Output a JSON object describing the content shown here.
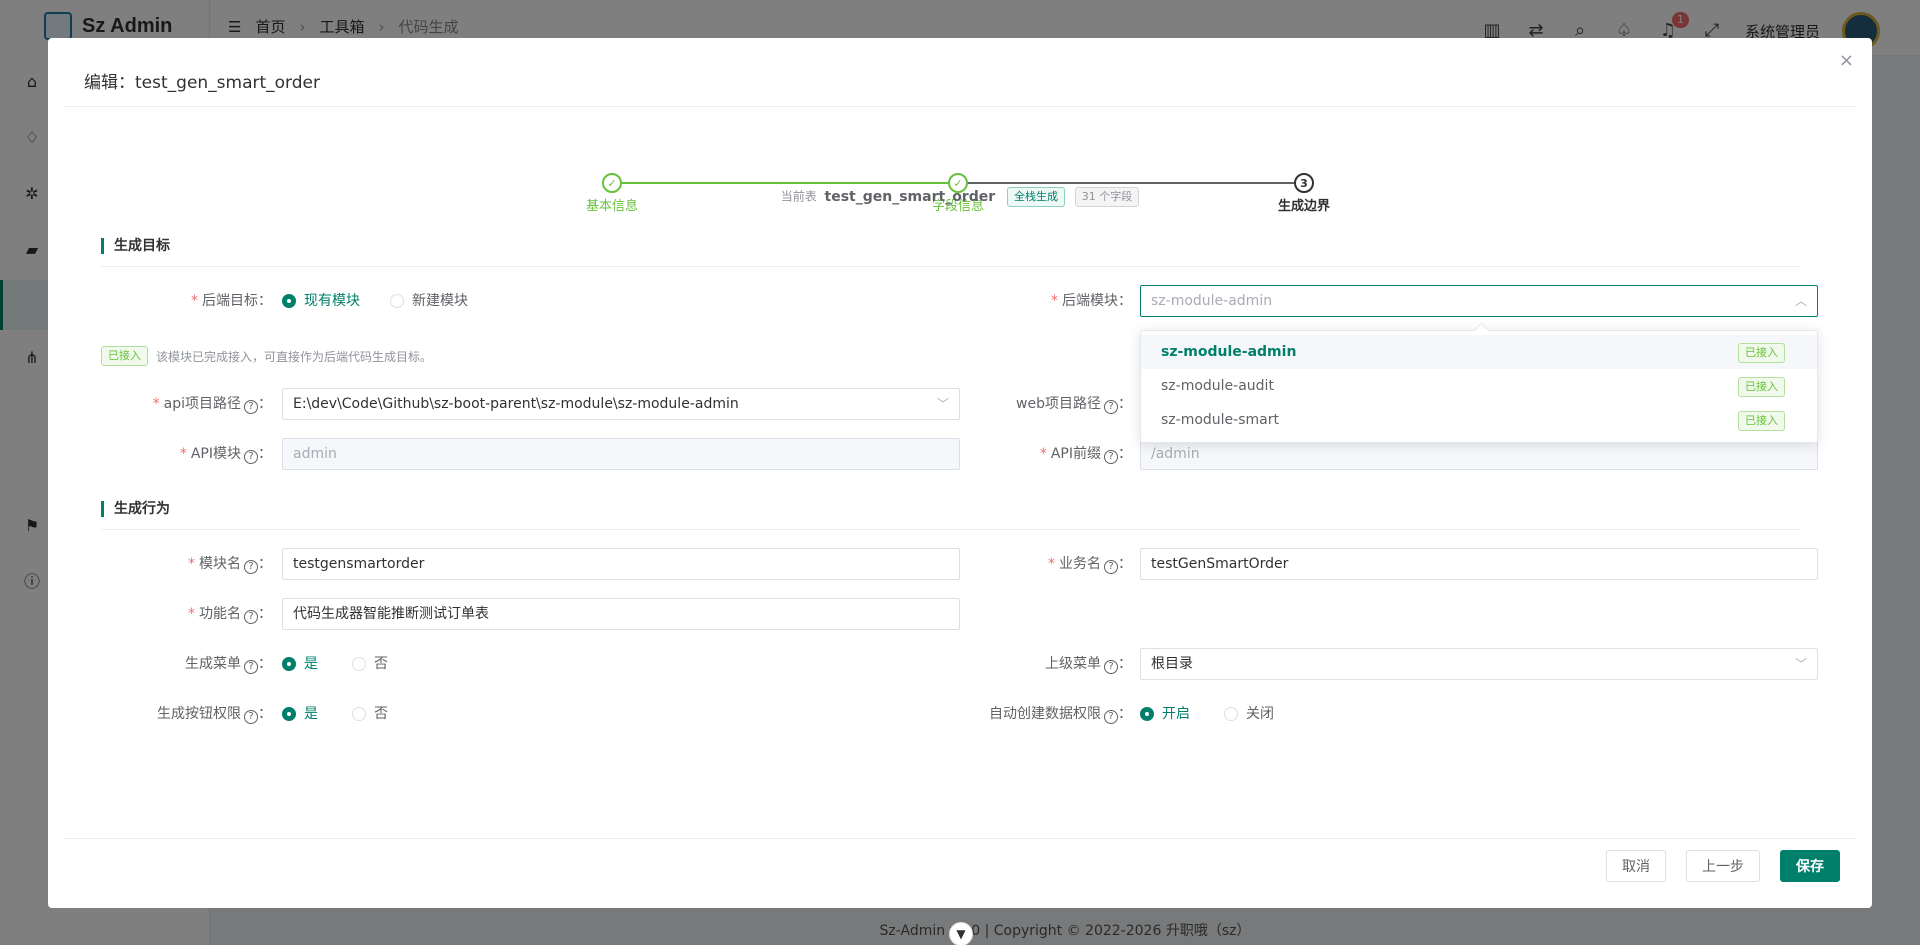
{
  "app": {
    "brand": "Sz Admin",
    "breadcrumb": [
      "首页",
      "工具箱",
      "代码生成"
    ],
    "notifications_count": "1",
    "user_name": "系统管理员",
    "footer": "Sz-Admin v1.0 | Copyright © 2022-2026 升职哦（sz）"
  },
  "dialog": {
    "title": "编辑：test_gen_smart_order",
    "close": "×",
    "steps": [
      {
        "label": "基本信息",
        "icon": "✓",
        "status": "done"
      },
      {
        "label": "字段信息",
        "icon": "✓",
        "status": "done"
      },
      {
        "label": "生成边界",
        "icon": "3",
        "status": "active"
      }
    ],
    "current_table_label": "当前表",
    "current_table_name": "test_gen_smart_order",
    "table_tag": "全栈生成",
    "field_count_tag": "31 个字段",
    "sections": {
      "target": "生成目标",
      "behavior": "生成行为"
    },
    "form": {
      "backend_target_label": "后端目标",
      "backend_target_options": [
        "现有模块",
        "新建模块"
      ],
      "backend_target_selected": "现有模块",
      "backend_module_label": "后端模块",
      "backend_module_placeholder": "sz-module-admin",
      "hint_tag": "已接入",
      "hint_text": "该模块已完成接入，可直接作为后端代码生成目标。",
      "api_path_label": "api项目路径",
      "api_path_value": "E:\\dev\\Code\\Github\\sz-boot-parent\\sz-module\\sz-module-admin",
      "web_path_label": "web项目路径",
      "api_module_label": "API模块",
      "api_module_value": "admin",
      "api_prefix_label": "API前缀",
      "api_prefix_value": "/admin",
      "module_name_label": "模块名",
      "module_name_value": "testgensmartorder",
      "business_name_label": "业务名",
      "business_name_value": "testGenSmartOrder",
      "function_name_label": "功能名",
      "function_name_value": "代码生成器智能推断测试订单表",
      "gen_menu_label": "生成菜单",
      "gen_menu_options": [
        "是",
        "否"
      ],
      "parent_menu_label": "上级菜单",
      "parent_menu_value": "根目录",
      "gen_btn_perm_label": "生成按钮权限",
      "gen_btn_perm_options": [
        "是",
        "否"
      ],
      "auto_data_perm_label": "自动创建数据权限",
      "auto_data_perm_options": [
        "开启",
        "关闭"
      ]
    },
    "dropdown": [
      {
        "label": "sz-module-admin",
        "tag": "已接入",
        "selected": true
      },
      {
        "label": "sz-module-audit",
        "tag": "已接入",
        "selected": false
      },
      {
        "label": "sz-module-smart",
        "tag": "已接入",
        "selected": false
      }
    ],
    "buttons": {
      "cancel": "取消",
      "prev": "上一步",
      "save": "保存"
    }
  },
  "colors": {
    "primary": "#007f6a",
    "success": "#67c23a",
    "required": "#f56c6c"
  }
}
